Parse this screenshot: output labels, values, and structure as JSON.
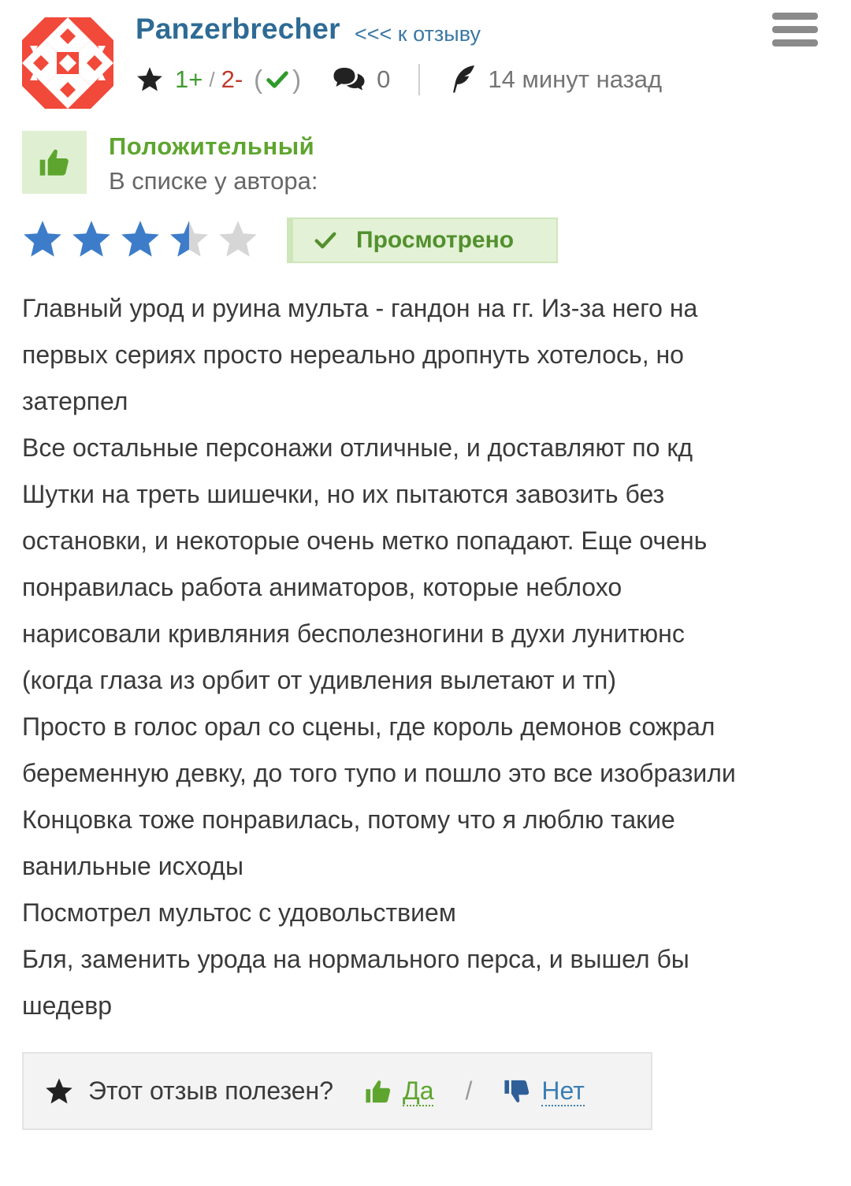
{
  "header": {
    "username": "Panzerbrecher",
    "back_link": "<<< к отзыву"
  },
  "meta": {
    "votes_positive": "1+",
    "votes_separator": "/",
    "votes_negative": "2-",
    "paren_open": "(",
    "paren_close": ")",
    "comments_count": "0",
    "posted_time": "14 минут назад"
  },
  "sentiment": {
    "label": "Положительный",
    "list_label": "В списке у автора:"
  },
  "rating": {
    "value": 3.5,
    "max": 5,
    "filled_color": "#3d7cc9",
    "empty_color": "#d6d6d6"
  },
  "status_badge": {
    "label": "Просмотрено"
  },
  "review": {
    "lines": [
      "Главный урод и руина мульта - гандон на гг. Из-за него на",
      "первых сериях просто нереально дропнуть хотелось, но",
      "затерпел",
      "Все остальные персонажи отличные, и доставляют по кд",
      "Шутки на треть шишечки, но их пытаются завозить без",
      "остановки, и некоторые очень метко попадают. Еще очень",
      "понравилась работа аниматоров, которые неблохо",
      "нарисовали кривляния бесполезногини в духи лунитюнс",
      "(когда глаза из орбит от удивления вылетают и тп)",
      "Просто в голос орал со сцены, где король демонов сожрал",
      "беременную девку, до того тупо и пошло это все изобразили",
      "Концовка тоже понравилась, потому что я люблю такие",
      "ванильные исходы",
      "Посмотрел мультос с удовольствием",
      "Бля, заменить урода на нормального перса, и вышел бы",
      "шедевр"
    ]
  },
  "helpful": {
    "question": "Этот отзыв полезен?",
    "yes": "Да",
    "separator": "/",
    "no": "Нет"
  },
  "colors": {
    "username": "#2e6b94",
    "link": "#3c7fb3",
    "positive": "#5ea52f",
    "negative": "#c0392b",
    "avatar_red": "#f1493a"
  }
}
